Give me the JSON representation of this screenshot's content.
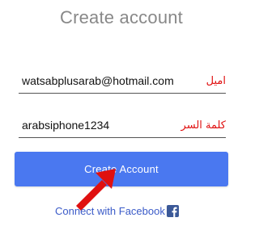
{
  "page": {
    "title": "Create account"
  },
  "form": {
    "email": {
      "value": "watsabplusarab@hotmail.com",
      "annotation": "اميل"
    },
    "password": {
      "value": "arabsiphone1234",
      "annotation": "كلمة السر"
    }
  },
  "create_button": {
    "label": "Create Account"
  },
  "facebook": {
    "label": "Connect with Facebook",
    "icon": "facebook-icon"
  },
  "colors": {
    "primary_button": "#4a78f0",
    "annotation_red": "#e01010",
    "link_blue": "#3b5bc8",
    "facebook_brand": "#3b5998"
  }
}
